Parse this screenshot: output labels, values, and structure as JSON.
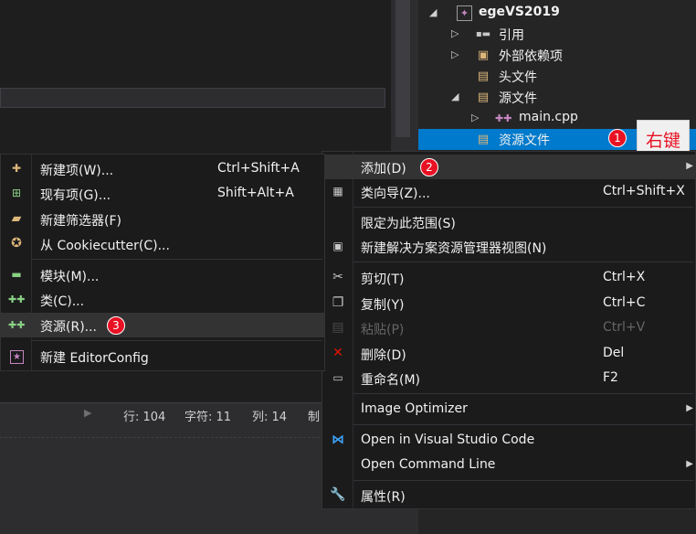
{
  "solution_explorer": {
    "items": [
      {
        "label": "egeVS2019",
        "arrow": "◢",
        "icon": "project-icon"
      },
      {
        "label": "引用",
        "arrow": "▷",
        "icon": "references-icon"
      },
      {
        "label": "外部依赖项",
        "arrow": "▷",
        "icon": "external-deps-icon"
      },
      {
        "label": "头文件",
        "arrow": "",
        "icon": "filter-folder-icon"
      },
      {
        "label": "源文件",
        "arrow": "◢",
        "icon": "filter-folder-icon"
      },
      {
        "label": "main.cpp",
        "arrow": "▷",
        "icon": "cpp-file-icon"
      },
      {
        "label": "资源文件",
        "arrow": "",
        "icon": "filter-folder-icon",
        "selected": true
      }
    ]
  },
  "annotations": {
    "badge_1": "1",
    "badge_2": "2",
    "badge_3": "3",
    "right_click_label": "右键"
  },
  "status_bar": {
    "line": "行: 104",
    "char": "字符: 11",
    "col": "列: 14",
    "mode": "制"
  },
  "context_menu": {
    "items": [
      {
        "label": "添加(D)",
        "icon": "",
        "shortcut": "",
        "submenu": true,
        "highlighted": true
      },
      {
        "label": "类向导(Z)...",
        "icon": "class-wizard-icon",
        "shortcut": "Ctrl+Shift+X"
      },
      {
        "label": "限定为此范围(S)",
        "icon": "",
        "shortcut": ""
      },
      {
        "label": "新建解决方案资源管理器视图(N)",
        "icon": "new-view-icon",
        "shortcut": ""
      },
      {
        "label": "剪切(T)",
        "icon": "scissors-icon",
        "shortcut": "Ctrl+X"
      },
      {
        "label": "复制(Y)",
        "icon": "copy-icon",
        "shortcut": "Ctrl+C"
      },
      {
        "label": "粘贴(P)",
        "icon": "paste-icon",
        "shortcut": "Ctrl+V",
        "disabled": true
      },
      {
        "label": "删除(D)",
        "icon": "delete-icon",
        "shortcut": "Del"
      },
      {
        "label": "重命名(M)",
        "icon": "rename-icon",
        "shortcut": "F2"
      },
      {
        "label": "Image Optimizer",
        "icon": "",
        "shortcut": "",
        "submenu": true
      },
      {
        "label": "Open in Visual Studio Code",
        "icon": "vscode-icon",
        "shortcut": ""
      },
      {
        "label": "Open Command Line",
        "icon": "",
        "shortcut": "",
        "submenu": true
      },
      {
        "label": "属性(R)",
        "icon": "wrench-icon",
        "shortcut": ""
      }
    ]
  },
  "add_submenu": {
    "items": [
      {
        "label": "新建项(W)...",
        "icon": "new-item-icon",
        "shortcut": "Ctrl+Shift+A"
      },
      {
        "label": "现有项(G)...",
        "icon": "existing-item-icon",
        "shortcut": "Shift+Alt+A"
      },
      {
        "label": "新建筛选器(F)",
        "icon": "new-filter-icon",
        "shortcut": ""
      },
      {
        "label": "从 Cookiecutter(C)...",
        "icon": "cookiecutter-icon",
        "shortcut": ""
      },
      {
        "label": "模块(M)...",
        "icon": "module-icon",
        "shortcut": ""
      },
      {
        "label": "类(C)...",
        "icon": "class-icon",
        "shortcut": ""
      },
      {
        "label": "资源(R)...",
        "icon": "resource-icon",
        "shortcut": "",
        "highlighted": true
      },
      {
        "label": "新建 EditorConfig",
        "icon": "editorconfig-icon",
        "shortcut": ""
      }
    ]
  },
  "colors": {
    "accent": "#007acc",
    "badge_red": "#e81123",
    "menu_bg": "#1b1b1c",
    "highlight": "#333334"
  }
}
